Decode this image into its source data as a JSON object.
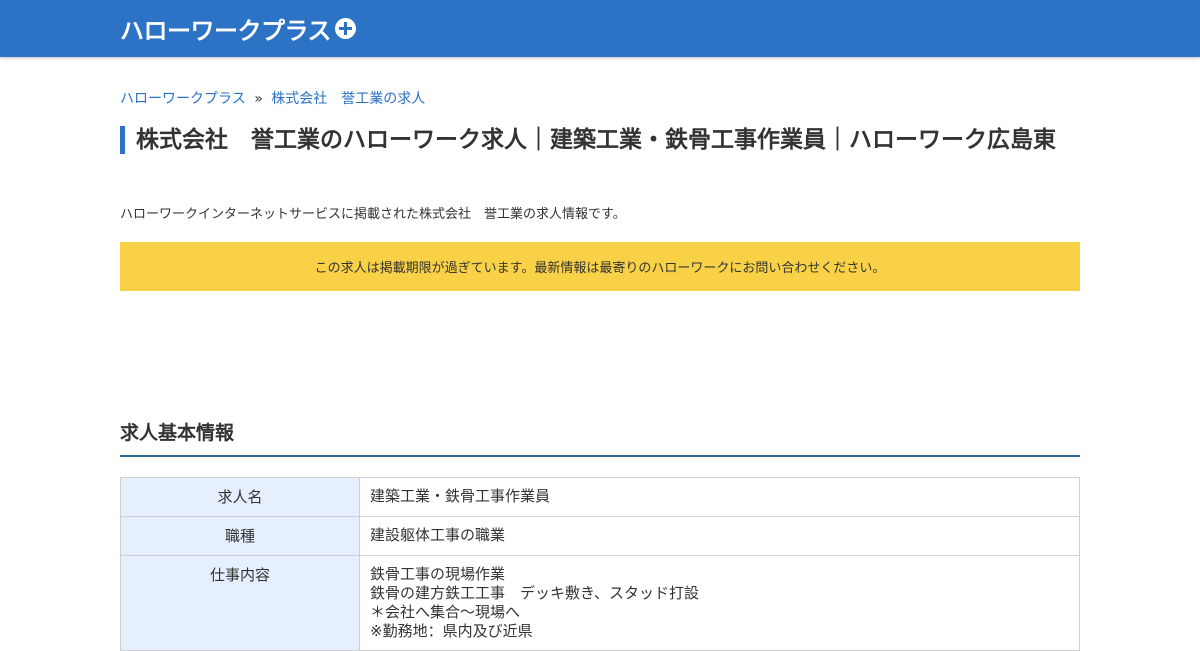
{
  "header": {
    "logo_text": "ハローワークプラス",
    "logo_icon": "plus-circle-icon",
    "bg_color": "#2c72c5"
  },
  "breadcrumb": {
    "home": "ハローワークプラス",
    "separator": "»",
    "current": "株式会社　誉工業の求人"
  },
  "page": {
    "title": "株式会社　誉工業のハローワーク求人｜建築工業・鉄骨工事作業員｜ハローワーク広島東",
    "description": "ハローワークインターネットサービスに掲載された株式会社　誉工業の求人情報です。"
  },
  "notice": {
    "text": "この求人は掲載期限が過ぎています。最新情報は最寄りのハローワークにお問い合わせください。",
    "bg_color": "#f8d146"
  },
  "section": {
    "title": "求人基本情報"
  },
  "table": {
    "rows": [
      {
        "label": "求人名",
        "value": "建築工業・鉄骨工事作業員"
      },
      {
        "label": "職種",
        "value": "建設躯体工事の職業"
      },
      {
        "label": "仕事内容",
        "lines": [
          "鉄骨工事の現場作業",
          "鉄骨の建方鉄工工事　デッキ敷き、スタッド打設",
          "＊会社へ集合～現場へ",
          "※勤務地：県内及び近県"
        ]
      }
    ]
  }
}
